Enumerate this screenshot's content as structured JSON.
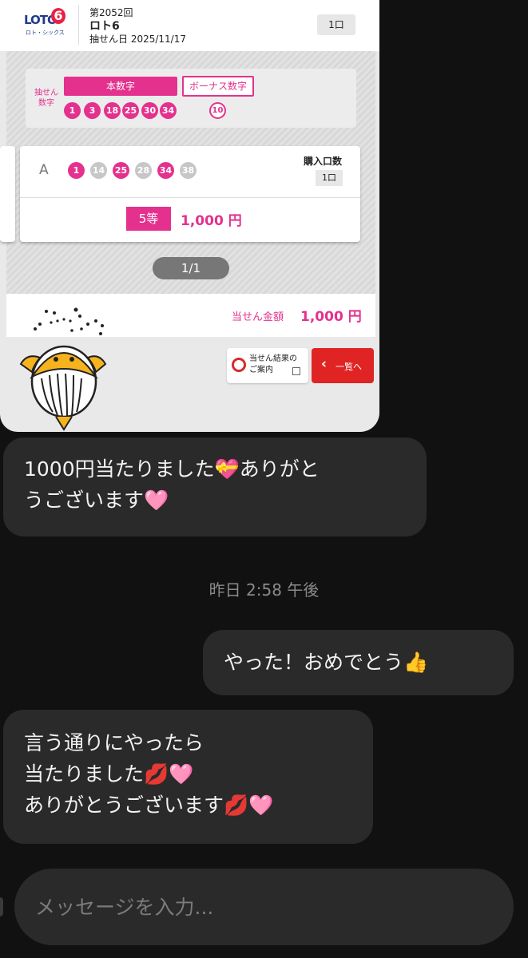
{
  "lottery": {
    "logo_text": "LOTO",
    "logo_num": "6",
    "logo_sub": "ロト・シックス",
    "draw_no": "第2052回",
    "game_name": "ロト6",
    "draw_date": "抽せん日 2025/11/17",
    "qty": "1口",
    "winning_label": "抽せん数字",
    "main_label": "本数字",
    "bonus_label": "ボーナス数字",
    "main_numbers": [
      "1",
      "3",
      "18",
      "25",
      "30",
      "34"
    ],
    "bonus_number": "10",
    "ticket": {
      "row": "A",
      "numbers": [
        {
          "n": "1",
          "hit": true
        },
        {
          "n": "14",
          "hit": false
        },
        {
          "n": "25",
          "hit": true
        },
        {
          "n": "28",
          "hit": false
        },
        {
          "n": "34",
          "hit": true
        },
        {
          "n": "38",
          "hit": false
        }
      ],
      "buy_label": "購入口数",
      "buy_qty": "1口",
      "prize_rank": "5等",
      "prize_amount": "1,000 円"
    },
    "pager": "1/1",
    "total_label": "当せん金額",
    "total_amount": "1,000 円",
    "guide_btn": "当せん結果の ご案内",
    "list_btn": "一覧へ"
  },
  "chat": {
    "msg1": "1000円当たりました💝ありがと\nうございます🩷",
    "timestamp": "昨日 2:58 午後",
    "msg2": "やった！おめでとう👍",
    "msg3": "言う通りにやったら\n当たりました💋🩷\nありがとうございます💋🩷",
    "input_placeholder": "メッセージを入力..."
  },
  "colors": {
    "accent_pink": "#e4318e",
    "accent_red": "#e02424",
    "bubble_bg": "#2a2a2a",
    "chat_bg": "#111111"
  }
}
